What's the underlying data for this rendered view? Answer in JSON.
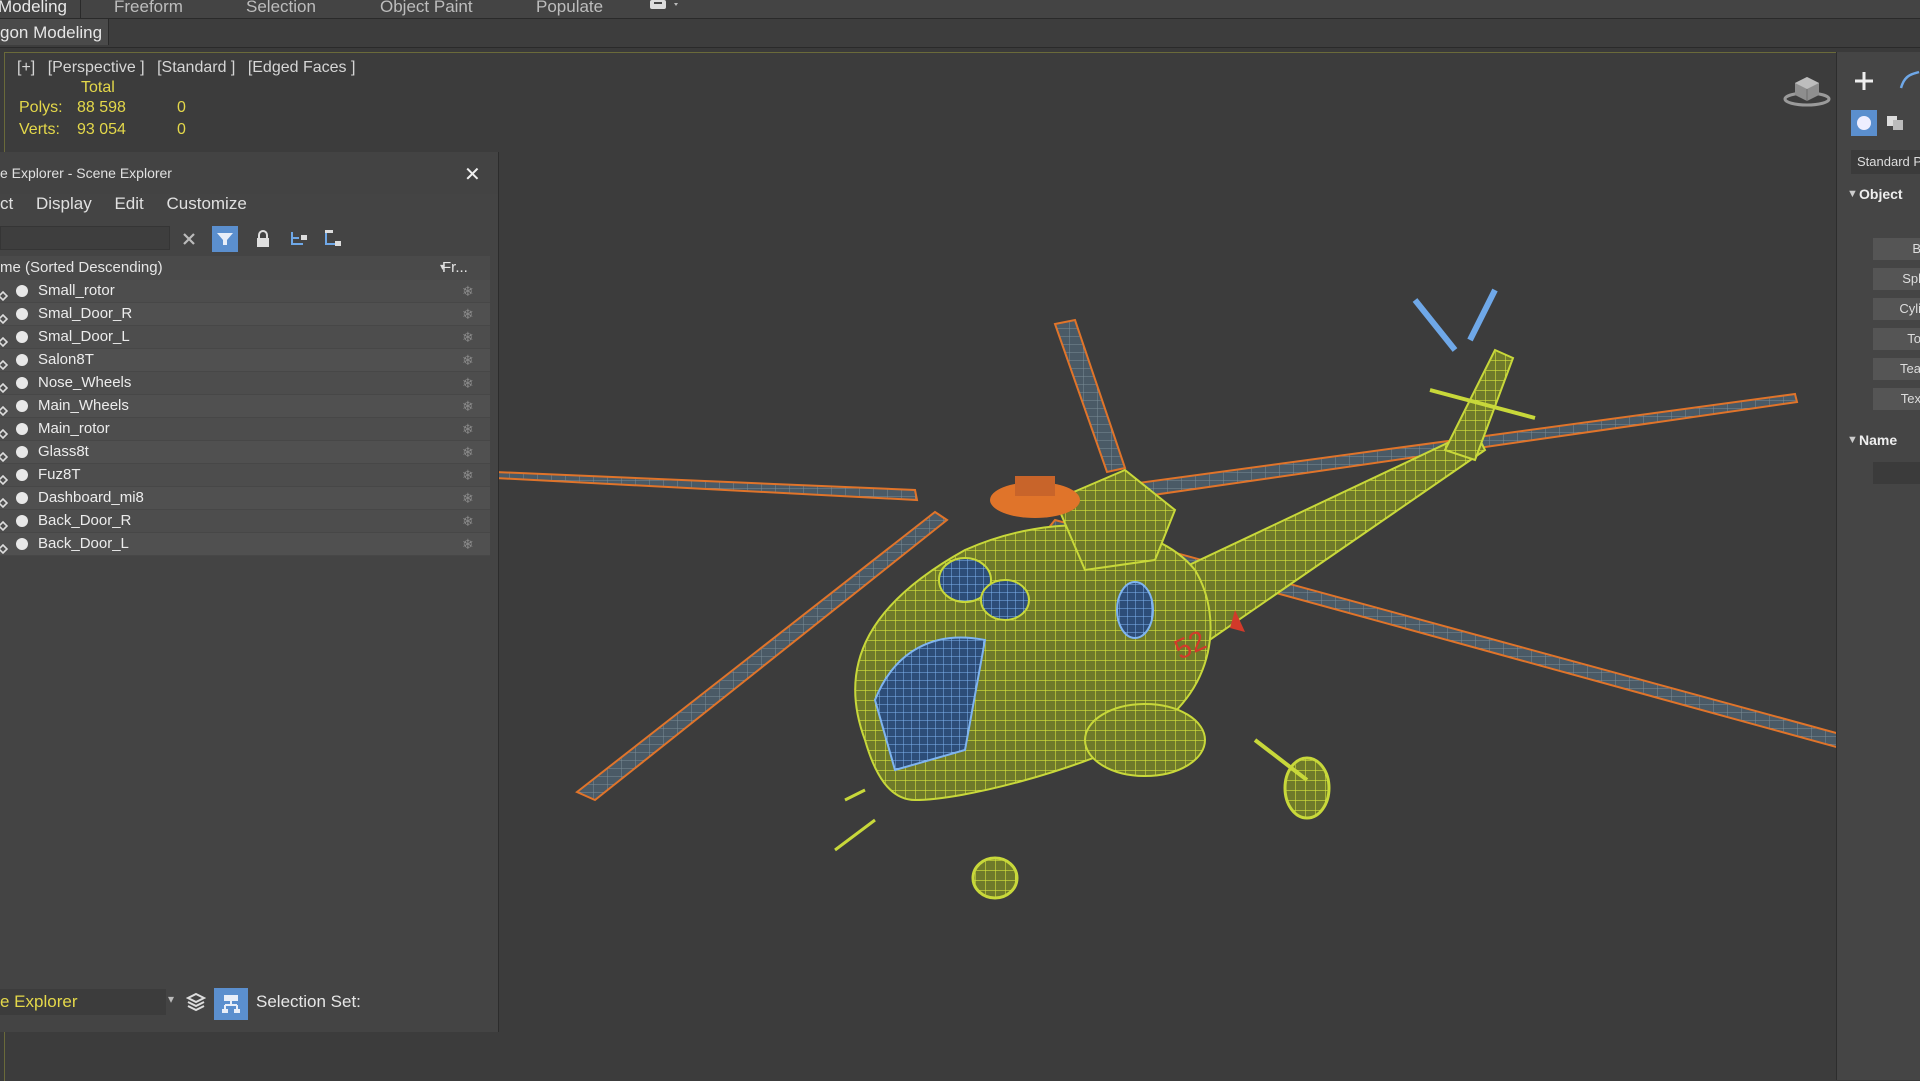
{
  "ribbon": {
    "tabs": [
      "Modeling",
      "Freeform",
      "Selection",
      "Object Paint",
      "Populate"
    ],
    "active_tab": "Modeling",
    "subtab": "gon Modeling"
  },
  "viewport": {
    "labels": [
      "[+]",
      "[Perspective ]",
      "[Standard ]",
      "[Edged Faces ]"
    ],
    "stats": {
      "total_label": "Total",
      "polys_label": "Polys:",
      "polys_value": "88 598",
      "polys_sel": "0",
      "verts_label": "Verts:",
      "verts_value": "93 054",
      "verts_sel": "0"
    },
    "helicopter_marking": "52"
  },
  "explorer": {
    "title": "e Explorer - Scene Explorer",
    "menu": [
      "ct",
      "Display",
      "Edit",
      "Customize"
    ],
    "header_name": "me (Sorted Descending)",
    "header_frozen": "Fr...",
    "objects": [
      "Small_rotor",
      "Smal_Door_R",
      "Smal_Door_L",
      "Salon8T",
      "Nose_Wheels",
      "Main_Wheels",
      "Main_rotor",
      "Glass8t",
      "Fuz8T",
      "Dashboard_mi8",
      "Back_Door_R",
      "Back_Door_L"
    ],
    "frozen_glyph": "❄",
    "footer_mode": "e Explorer",
    "footer_selection_set": "Selection Set:"
  },
  "command_panel": {
    "dropdown": "Standard P",
    "section_object": "Object",
    "section_name": "Name",
    "buttons": [
      "B",
      "Spl",
      "Cyli",
      "To",
      "Tea",
      "Tex"
    ]
  },
  "colors": {
    "wire_yellow": "#c8d83a",
    "rotor_orange": "#e0742a",
    "glass_blue": "#6fa8e8",
    "stats_yellow": "#e4d84a",
    "highlight_blue": "#5b8fce"
  }
}
